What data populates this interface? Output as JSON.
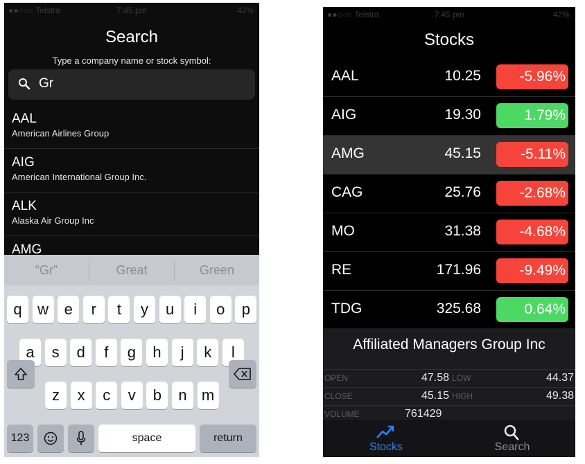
{
  "left": {
    "status": {
      "carrier": "●●○○○ Telstra",
      "time": "7:45 pm",
      "battery": "42%"
    },
    "title": "Search",
    "prompt": "Type a company name or stock symbol:",
    "search_value": "Gr",
    "results": [
      {
        "symbol": "AAL",
        "name": "American Airlines Group"
      },
      {
        "symbol": "AIG",
        "name": "American International Group Inc."
      },
      {
        "symbol": "ALK",
        "name": "Alaska Air Group Inc"
      },
      {
        "symbol": "AMG",
        "name": ""
      }
    ],
    "suggestions": [
      "“Gr”",
      "Great",
      "Green"
    ],
    "keys_row1": [
      "q",
      "w",
      "e",
      "r",
      "t",
      "y",
      "u",
      "i",
      "o",
      "p"
    ],
    "keys_row2": [
      "a",
      "s",
      "d",
      "f",
      "g",
      "h",
      "j",
      "k",
      "l"
    ],
    "keys_row3": [
      "z",
      "x",
      "c",
      "v",
      "b",
      "n",
      "m"
    ],
    "key_123": "123",
    "key_space": "space",
    "key_return": "return"
  },
  "right": {
    "status": {
      "carrier": "●●○○○ Telstra",
      "time": "7:45 pm",
      "battery": "42%"
    },
    "title": "Stocks",
    "stocks": [
      {
        "symbol": "AAL",
        "price": "10.25",
        "change": "-5.96%"
      },
      {
        "symbol": "AIG",
        "price": "19.30",
        "change": "1.79%"
      },
      {
        "symbol": "AMG",
        "price": "45.15",
        "change": "-5.11%"
      },
      {
        "symbol": "CAG",
        "price": "25.76",
        "change": "-2.68%"
      },
      {
        "symbol": "MO",
        "price": "31.38",
        "change": "-4.68%"
      },
      {
        "symbol": "RE",
        "price": "171.96",
        "change": "-9.49%"
      },
      {
        "symbol": "TDG",
        "price": "325.68",
        "change": "0.64%"
      }
    ],
    "selected_index": 2,
    "detail": {
      "name": "Affiliated Managers Group Inc",
      "open_label": "OPEN",
      "open": "47.58",
      "low_label": "LOW",
      "low": "44.37",
      "close_label": "CLOSE",
      "close": "45.15",
      "high_label": "HIGH",
      "high": "49.38",
      "volume_label": "VOLUME",
      "volume": "761429"
    },
    "tabs": [
      {
        "label": "Stocks",
        "icon": "trend-chart-icon",
        "active": true
      },
      {
        "label": "Search",
        "icon": "search-icon",
        "active": false
      }
    ]
  },
  "colors": {
    "negative": "#f7443a",
    "positive": "#4cd963",
    "active_tab": "#2f80ed",
    "inactive_tab": "#8e8e93"
  }
}
